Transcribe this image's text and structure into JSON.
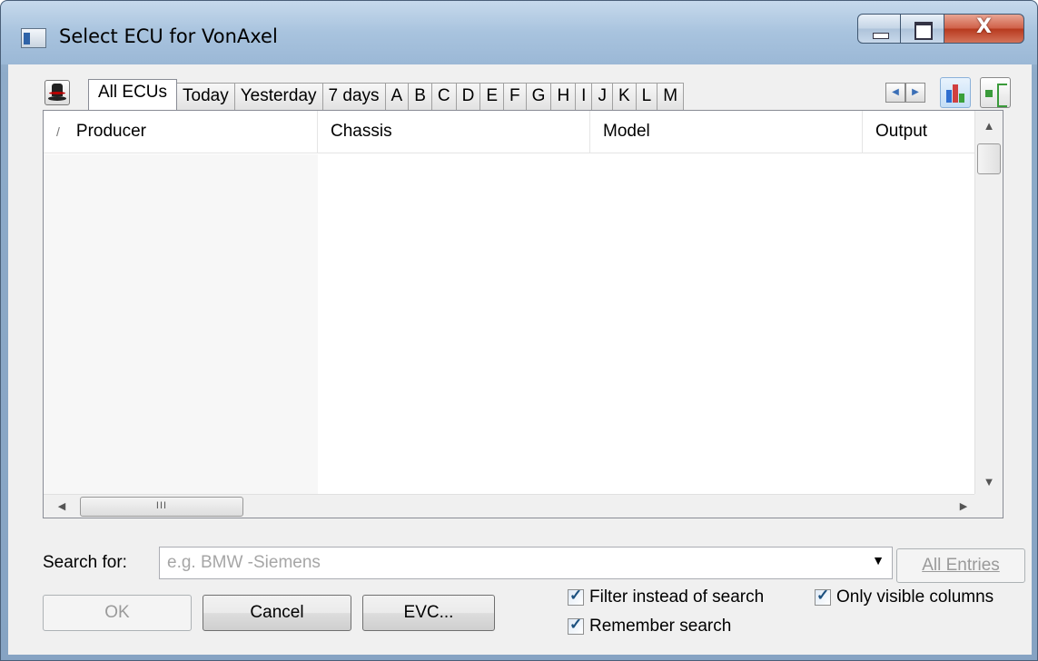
{
  "window": {
    "title": "Select ECU for VonAxel",
    "close_glyph": "X"
  },
  "tabs": [
    {
      "label": "All ECUs",
      "active": true
    },
    {
      "label": "Today"
    },
    {
      "label": "Yesterday"
    },
    {
      "label": "7 days"
    },
    {
      "label": "A"
    },
    {
      "label": "B"
    },
    {
      "label": "C"
    },
    {
      "label": "D"
    },
    {
      "label": "E"
    },
    {
      "label": "F"
    },
    {
      "label": "G"
    },
    {
      "label": "H"
    },
    {
      "label": "I"
    },
    {
      "label": "J"
    },
    {
      "label": "K"
    },
    {
      "label": "L"
    },
    {
      "label": "M"
    }
  ],
  "list": {
    "sort_glyph": "/",
    "columns": [
      "Producer",
      "Chassis",
      "Model",
      "Output"
    ],
    "rows": [],
    "hscroll_grip": "III"
  },
  "search": {
    "label": "Search for:",
    "placeholder": "e.g. BMW -Siemens",
    "value": "",
    "all_entries_label": "All Entries"
  },
  "buttons": {
    "ok": "OK",
    "cancel": "Cancel",
    "evc": "EVC..."
  },
  "options": {
    "filter_instead": {
      "label": "Filter instead of search",
      "checked": true
    },
    "only_visible": {
      "label": "Only visible columns",
      "checked": true
    },
    "remember_search": {
      "label": "Remember search",
      "checked": true
    }
  },
  "colors": {
    "accent": "#3b6fb6",
    "close": "#c8452c",
    "dialog_bg": "#f0f0f0"
  }
}
